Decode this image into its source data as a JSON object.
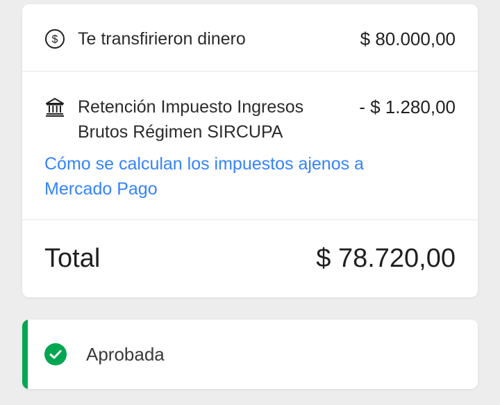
{
  "summary": {
    "transfer": {
      "icon": "dollar-circle-icon",
      "label": "Te transfirieron dinero",
      "amount": "$ 80.000,00"
    },
    "retention": {
      "icon": "bank-icon",
      "label": "Retención Impuesto Ingresos Brutos Régimen SIRCUPA",
      "amount": "- $ 1.280,00"
    },
    "tax_link": "Cómo se calculan los impuestos ajenos a Mercado Pago",
    "total": {
      "label": "Total",
      "amount": "$ 78.720,00"
    }
  },
  "status": {
    "icon": "check-circle-icon",
    "label": "Aprobada",
    "accent_color": "#00a650"
  },
  "colors": {
    "link": "#3483fa",
    "text": "#1f1f1f",
    "background": "#ededed",
    "card": "#ffffff"
  }
}
